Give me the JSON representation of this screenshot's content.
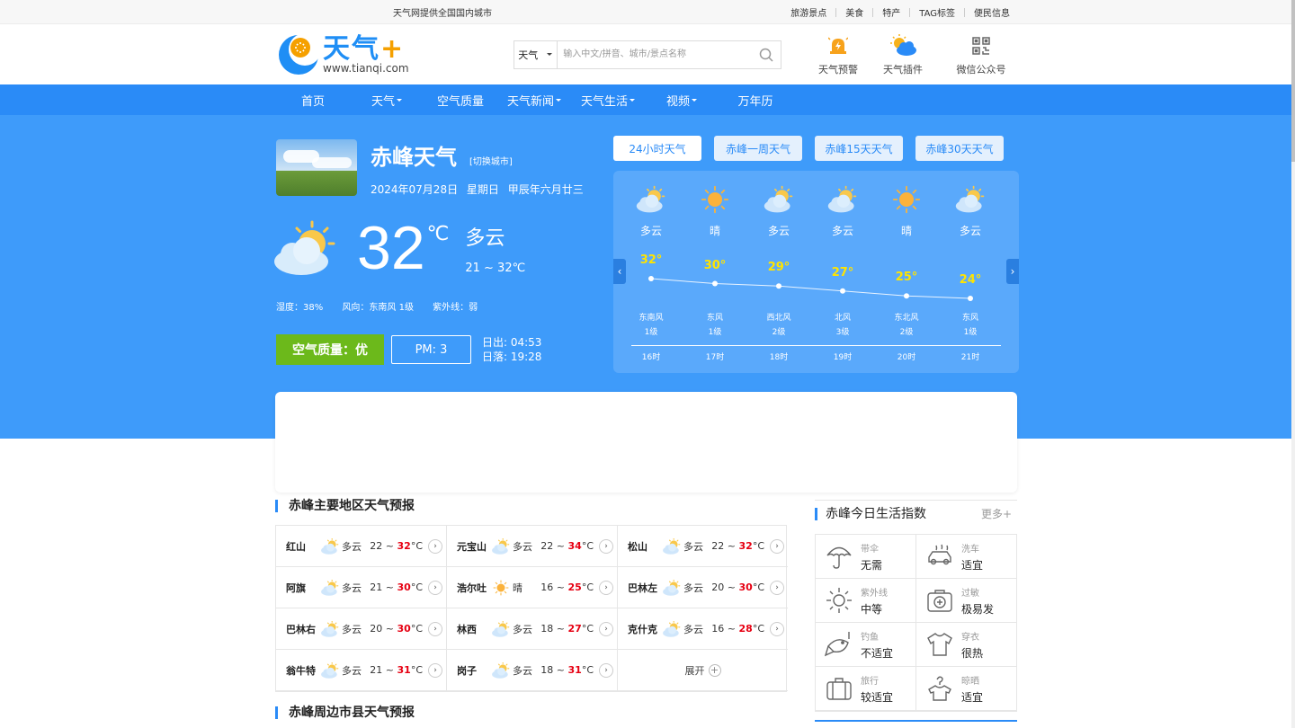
{
  "topbar": {
    "slogan": "天气网提供全国国内城市",
    "links": [
      "旅游景点",
      "美食",
      "特产",
      "TAG标签",
      "便民信息"
    ]
  },
  "header": {
    "logo_cn": "天气",
    "logo_plus": "+",
    "logo_url": "www.tianqi.com",
    "search_select": "天气",
    "search_placeholder": "输入中文/拼音、城市/景点名称",
    "tools": [
      {
        "label": "天气预警",
        "icon": "alert-bell-icon"
      },
      {
        "label": "天气插件",
        "icon": "sun-cloud-icon"
      },
      {
        "label": "微信公众号",
        "icon": "qrcode-icon"
      }
    ]
  },
  "nav": {
    "items": [
      "首页",
      "天气",
      "空气质量",
      "天气新闻",
      "天气生活",
      "视频",
      "万年历"
    ],
    "has_caret": [
      false,
      true,
      false,
      true,
      true,
      true,
      false
    ]
  },
  "city": {
    "name": "赤峰天气",
    "switch": "[切换城市]",
    "date": "2024年07月28日",
    "weekday": "星期日",
    "lunar": "甲辰年六月廿三"
  },
  "current": {
    "temp": "32",
    "unit": "℃",
    "desc": "多云",
    "range": "21 ~ 32℃",
    "humidity": "湿度：38%",
    "wind": "风向：东南风 1级",
    "uv": "紫外线：弱",
    "air": "空气质量：优",
    "pm": "PM: 3",
    "sunrise": "日出: 04:53",
    "sunset": "日落: 19:28"
  },
  "tabs": [
    "24小时天气",
    "赤峰一周天气",
    "赤峰15天天气",
    "赤峰30天天气"
  ],
  "hourly": [
    {
      "desc": "多云",
      "temp": "32°",
      "wind": "东南风",
      "level": "1级",
      "time": "16时",
      "icon": "partly-cloudy"
    },
    {
      "desc": "晴",
      "temp": "30°",
      "wind": "东风",
      "level": "1级",
      "time": "17时",
      "icon": "sunny"
    },
    {
      "desc": "多云",
      "temp": "29°",
      "wind": "西北风",
      "level": "2级",
      "time": "18时",
      "icon": "partly-cloudy"
    },
    {
      "desc": "多云",
      "temp": "27°",
      "wind": "北风",
      "level": "3级",
      "time": "19时",
      "icon": "partly-cloudy"
    },
    {
      "desc": "晴",
      "temp": "25°",
      "wind": "东北风",
      "level": "2级",
      "time": "20时",
      "icon": "sunny"
    },
    {
      "desc": "多云",
      "temp": "24°",
      "wind": "东风",
      "level": "1级",
      "time": "21时",
      "icon": "partly-cloudy"
    }
  ],
  "hourly_values": [
    32,
    30,
    29,
    27,
    25,
    24
  ],
  "regions_title": "赤峰主要地区天气预报",
  "regions": [
    {
      "name": "红山",
      "desc": "多云",
      "low": "22 ~ ",
      "high": "32",
      "unit": "°C",
      "icon": "partly-cloudy"
    },
    {
      "name": "元宝山",
      "desc": "多云",
      "low": "22 ~ ",
      "high": "34",
      "unit": "°C",
      "icon": "partly-cloudy"
    },
    {
      "name": "松山",
      "desc": "多云",
      "low": "22 ~ ",
      "high": "32",
      "unit": "°C",
      "icon": "partly-cloudy"
    },
    {
      "name": "阿旗",
      "desc": "多云",
      "low": "21 ~ ",
      "high": "30",
      "unit": "°C",
      "icon": "partly-cloudy"
    },
    {
      "name": "浩尔吐",
      "desc": "晴",
      "low": "16 ~ ",
      "high": "25",
      "unit": "°C",
      "icon": "sunny"
    },
    {
      "name": "巴林左",
      "desc": "多云",
      "low": "20 ~ ",
      "high": "30",
      "unit": "°C",
      "icon": "partly-cloudy"
    },
    {
      "name": "巴林右",
      "desc": "多云",
      "low": "20 ~ ",
      "high": "30",
      "unit": "°C",
      "icon": "partly-cloudy"
    },
    {
      "name": "林西",
      "desc": "多云",
      "low": "18 ~ ",
      "high": "27",
      "unit": "°C",
      "icon": "partly-cloudy"
    },
    {
      "name": "克什克",
      "desc": "多云",
      "low": "16 ~ ",
      "high": "28",
      "unit": "°C",
      "icon": "partly-cloudy"
    },
    {
      "name": "翁牛特",
      "desc": "多云",
      "low": "21 ~ ",
      "high": "31",
      "unit": "°C",
      "icon": "partly-cloudy"
    },
    {
      "name": "岗子",
      "desc": "多云",
      "low": "18 ~ ",
      "high": "31",
      "unit": "°C",
      "icon": "partly-cloudy"
    }
  ],
  "expand_label": "展开",
  "nearby_title": "赤峰周边市县天气预报",
  "life": {
    "title": "赤峰今日生活指数",
    "more": "更多+",
    "items": [
      {
        "key": "带伞",
        "value": "无需",
        "icon": "umbrella-icon"
      },
      {
        "key": "洗车",
        "value": "适宜",
        "icon": "car-wash-icon"
      },
      {
        "key": "紫外线",
        "value": "中等",
        "icon": "uv-sun-icon"
      },
      {
        "key": "过敏",
        "value": "极易发",
        "icon": "medical-kit-icon"
      },
      {
        "key": "钓鱼",
        "value": "不适宜",
        "icon": "fish-icon"
      },
      {
        "key": "穿衣",
        "value": "很热",
        "icon": "shirt-icon"
      },
      {
        "key": "旅行",
        "value": "较适宜",
        "icon": "luggage-icon"
      },
      {
        "key": "晾晒",
        "value": "适宜",
        "icon": "hanger-icon"
      }
    ]
  },
  "colors": {
    "brand_blue": "#2a8bf7",
    "hero_blue": "#3e9bfa",
    "air_green": "#6cb91b",
    "hourly_temp": "#ffe400",
    "high_temp": "#e60012"
  }
}
